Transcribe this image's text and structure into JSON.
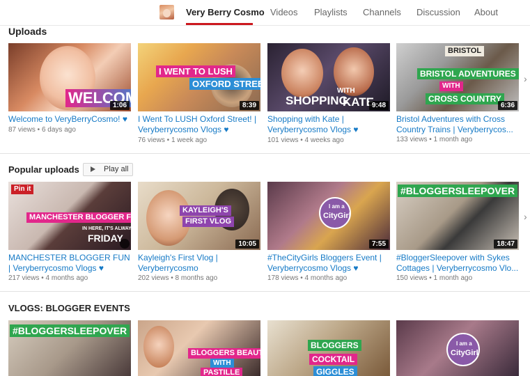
{
  "nav": {
    "channel_name": "Very Berry Cosmo",
    "tabs": [
      "Videos",
      "Playlists",
      "Channels",
      "Discussion",
      "About"
    ]
  },
  "sections": {
    "uploads": {
      "title": "Uploads",
      "videos": [
        {
          "title": "Welcome to VeryBerryCosmo! ♥",
          "views": "87 views",
          "age": "6 days ago",
          "duration": "1:06",
          "overlay": "WELCOME"
        },
        {
          "title": "I Went To LUSH Oxford Street! | Veryberrycosmo Vlogs ♥",
          "views": "76 views",
          "age": "1 week ago",
          "duration": "8:39",
          "overlay": [
            "I WENT TO LUSH",
            "OXFORD STREET!"
          ]
        },
        {
          "title": "Shopping with Kate | Veryberrycosmo Vlogs ♥",
          "views": "101 views",
          "age": "4 weeks ago",
          "duration": "9:48",
          "overlay": [
            "SHOPPING",
            "WITH",
            "KATE"
          ]
        },
        {
          "title": "Bristol Adventures with Cross Country Trains | Veryberrycos...",
          "views": "133 views",
          "age": "1 month ago",
          "duration": "6:36",
          "overlay": [
            "BRISTOL",
            "BRISTOL ADVENTURES",
            "WITH",
            "CROSS COUNTRY"
          ]
        }
      ]
    },
    "popular": {
      "title": "Popular uploads",
      "play_all": "Play all",
      "videos": [
        {
          "title": "MANCHESTER BLOGGER FUN | Veryberrycosmo Vlogs ♥",
          "views": "217 views",
          "age": "4 months ago",
          "duration": "",
          "overlay": [
            "MANCHESTER BLOGGER FUN",
            "IN HERE, IT'S ALWAYS",
            "FRIDAY",
            "Pin it"
          ]
        },
        {
          "title": "Kayleigh's First Vlog | Veryberrycosmo",
          "views": "202 views",
          "age": "8 months ago",
          "duration": "10:05",
          "overlay": [
            "KAYLEIGH'S",
            "FIRST VLOG"
          ]
        },
        {
          "title": "#TheCityGirls Bloggers Event | Veryberrycosmo Vlogs ♥",
          "views": "178 views",
          "age": "4 months ago",
          "duration": "7:55",
          "overlay": [
            "I am a",
            "CityGirl"
          ]
        },
        {
          "title": "#BloggerSleepover with Sykes Cottages | Veryberrycosmo Vlo...",
          "views": "150 views",
          "age": "1 month ago",
          "duration": "18:47",
          "overlay": [
            "#BLOGGERSLEEPOVER"
          ]
        }
      ]
    },
    "vlogs": {
      "title": "VLOGS: BLOGGER EVENTS",
      "thumbs": [
        {
          "overlay": [
            "#BLOGGERSLEEPOVER"
          ]
        },
        {
          "overlay": [
            "BLOGGERS BEAUTY",
            "WITH",
            "PASTILLE"
          ]
        },
        {
          "overlay": [
            "BLOGGERS",
            "COCKTAIL",
            "GIGGLES"
          ]
        },
        {
          "overlay": [
            "I am a",
            "CityGirl"
          ]
        }
      ]
    }
  },
  "colors": {
    "link": "#167ac6",
    "accent_red": "#cc181e",
    "meta": "#767676",
    "ov_pink": "#e2278b",
    "ov_blue": "#2c8ed6",
    "ov_green": "#2fa64f",
    "ov_purple": "#8e44ad"
  }
}
